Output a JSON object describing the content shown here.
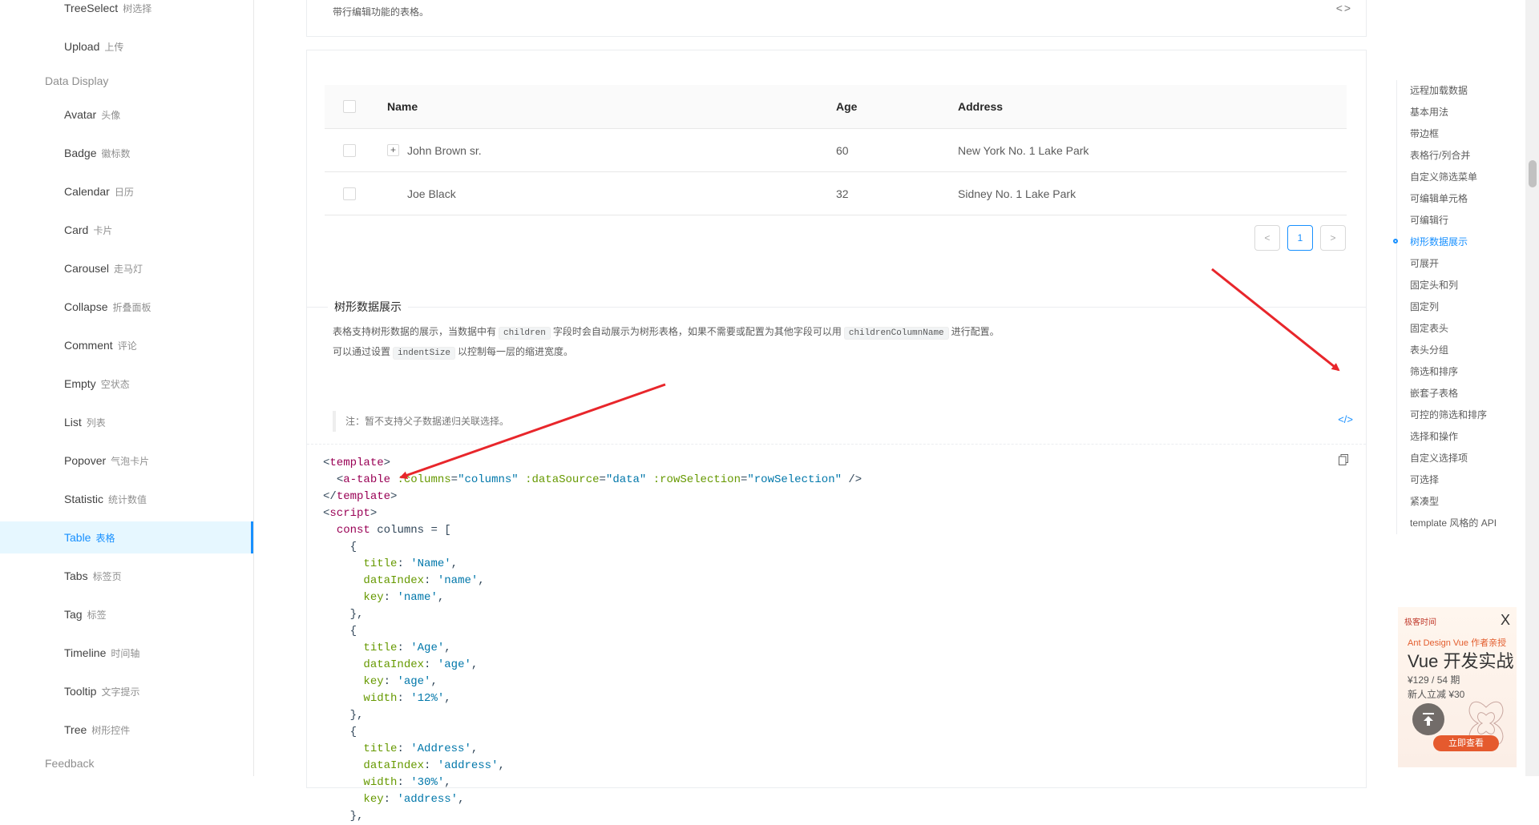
{
  "sidebar": {
    "items": [
      {
        "label": "TreeSelect",
        "zh": "树选择"
      },
      {
        "label": "Upload",
        "zh": "上传"
      }
    ],
    "group": "Data Display",
    "display_items": [
      {
        "label": "Avatar",
        "zh": "头像"
      },
      {
        "label": "Badge",
        "zh": "徽标数"
      },
      {
        "label": "Calendar",
        "zh": "日历"
      },
      {
        "label": "Card",
        "zh": "卡片"
      },
      {
        "label": "Carousel",
        "zh": "走马灯"
      },
      {
        "label": "Collapse",
        "zh": "折叠面板"
      },
      {
        "label": "Comment",
        "zh": "评论"
      },
      {
        "label": "Empty",
        "zh": "空状态"
      },
      {
        "label": "List",
        "zh": "列表"
      },
      {
        "label": "Popover",
        "zh": "气泡卡片"
      },
      {
        "label": "Statistic",
        "zh": "统计数值"
      },
      {
        "label": "Table",
        "zh": "表格",
        "active": true
      },
      {
        "label": "Tabs",
        "zh": "标签页"
      },
      {
        "label": "Tag",
        "zh": "标签"
      },
      {
        "label": "Timeline",
        "zh": "时间轴"
      },
      {
        "label": "Tooltip",
        "zh": "文字提示"
      },
      {
        "label": "Tree",
        "zh": "树形控件"
      }
    ],
    "feedback": "Feedback"
  },
  "top_card": {
    "description": "带行编辑功能的表格。",
    "code_icon": "< >"
  },
  "table": {
    "columns": [
      "Name",
      "Age",
      "Address"
    ],
    "rows": [
      {
        "name": "John Brown sr.",
        "age": "60",
        "address": "New York No. 1 Lake Park",
        "expandable": true
      },
      {
        "name": "Joe Black",
        "age": "32",
        "address": "Sidney No. 1 Lake Park",
        "expandable": false
      }
    ],
    "expand_symbol": "+",
    "pagination": {
      "prev": "<",
      "current": "1",
      "next": ">"
    }
  },
  "meta": {
    "title": "树形数据展示",
    "line1_a": "表格支持树形数据的展示，当数据中有",
    "line1_code1": "children",
    "line1_b": "字段时会自动展示为树形表格，如果不需要或配置为其他字段可以用",
    "line1_code2": "childrenColumnName",
    "line1_c": "进行配置。",
    "line2_a": "可以通过设置",
    "line2_code": "indentSize",
    "line2_b": "以控制每一层的缩进宽度。",
    "note": "注：暂不支持父子数据递归关联选择。",
    "code_toggle": "</>"
  },
  "code": {
    "t_open": "template",
    "t_comp": "a-table",
    "attr_cols": ":columns",
    "val_cols": "\"columns\"",
    "attr_ds": ":dataSource",
    "val_ds": "\"data\"",
    "attr_rs": ":rowSelection",
    "val_rs": "\"rowSelection\"",
    "script": "script",
    "kw_const": "const",
    "var_columns": "columns",
    "k_title": "title",
    "k_dataIndex": "dataIndex",
    "k_key": "key",
    "k_width": "width",
    "v_name_t": "'Name'",
    "v_name_d": "'name'",
    "v_name_k": "'name'",
    "v_age_t": "'Age'",
    "v_age_d": "'age'",
    "v_age_k": "'age'",
    "v_age_w": "'12%'",
    "v_addr_t": "'Address'",
    "v_addr_d": "'address'",
    "v_addr_w": "'30%'",
    "v_addr_k": "'address'"
  },
  "anchors": {
    "items": [
      "远程加载数据",
      "基本用法",
      "带边框",
      "表格行/列合并",
      "自定义筛选菜单",
      "可编辑单元格",
      "可编辑行",
      "树形数据展示",
      "可展开",
      "固定头和列",
      "固定列",
      "固定表头",
      "表头分组",
      "筛选和排序",
      "嵌套子表格",
      "可控的筛选和排序",
      "选择和操作",
      "自定义选择项",
      "可选择",
      "紧凑型",
      "template 风格的 API"
    ],
    "active_index": 7
  },
  "ad": {
    "brand": "极客时间",
    "close": "X",
    "line1": "Ant Design Vue 作者亲授",
    "line2": "Vue 开发实战",
    "line3": "¥129 / 54 期",
    "line4": "新人立减 ¥30",
    "button": "立即查看"
  },
  "colors": {
    "accent": "#1890ff",
    "annotation_arrow": "#e8262b"
  }
}
